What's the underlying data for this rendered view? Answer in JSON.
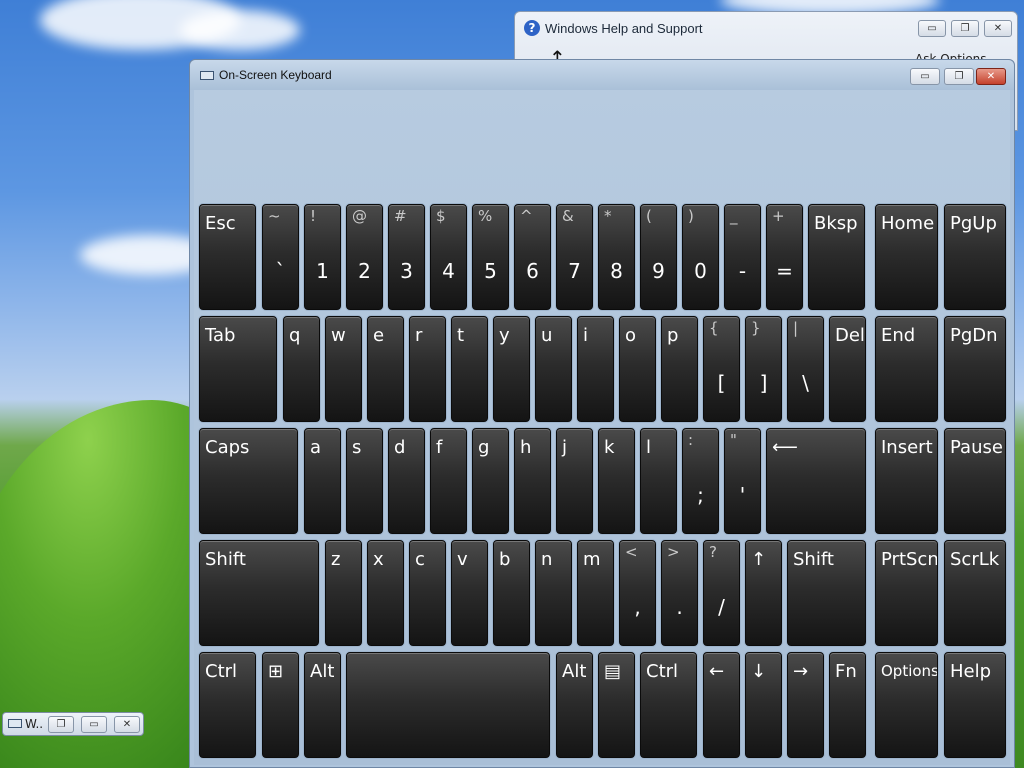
{
  "help_window": {
    "title": "Windows Help and Support",
    "icon_glyph": "?",
    "toolbar_text": "Ask   Options"
  },
  "osk_window": {
    "title": "On-Screen Keyboard"
  },
  "window_controls": {
    "minimize": "▭",
    "restore": "❐",
    "close": "✕"
  },
  "mini_window": {
    "label": "W.."
  },
  "keys": {
    "row1": [
      {
        "id": "esc",
        "label": "Esc"
      },
      {
        "id": "backtick",
        "shift": "~",
        "base": "`"
      },
      {
        "id": "1",
        "shift": "!",
        "base": "1"
      },
      {
        "id": "2",
        "shift": "@",
        "base": "2"
      },
      {
        "id": "3",
        "shift": "#",
        "base": "3"
      },
      {
        "id": "4",
        "shift": "$",
        "base": "4"
      },
      {
        "id": "5",
        "shift": "%",
        "base": "5"
      },
      {
        "id": "6",
        "shift": "^",
        "base": "6"
      },
      {
        "id": "7",
        "shift": "&",
        "base": "7"
      },
      {
        "id": "8",
        "shift": "*",
        "base": "8"
      },
      {
        "id": "9",
        "shift": "(",
        "base": "9"
      },
      {
        "id": "0",
        "shift": ")",
        "base": "0"
      },
      {
        "id": "minus",
        "shift": "_",
        "base": "-"
      },
      {
        "id": "equals",
        "shift": "+",
        "base": "="
      },
      {
        "id": "bksp",
        "label": "Bksp"
      },
      {
        "id": "home",
        "label": "Home"
      },
      {
        "id": "pgup",
        "label": "PgUp"
      }
    ],
    "row2": [
      {
        "id": "tab",
        "label": "Tab"
      },
      {
        "id": "q",
        "label": "q"
      },
      {
        "id": "w",
        "label": "w"
      },
      {
        "id": "e",
        "label": "e"
      },
      {
        "id": "r",
        "label": "r"
      },
      {
        "id": "t",
        "label": "t"
      },
      {
        "id": "y",
        "label": "y"
      },
      {
        "id": "u",
        "label": "u"
      },
      {
        "id": "i",
        "label": "i"
      },
      {
        "id": "o",
        "label": "o"
      },
      {
        "id": "p",
        "label": "p"
      },
      {
        "id": "lbracket",
        "shift": "{",
        "base": "["
      },
      {
        "id": "rbracket",
        "shift": "}",
        "base": "]"
      },
      {
        "id": "backslash",
        "shift": "|",
        "base": "\\"
      },
      {
        "id": "del",
        "label": "Del"
      },
      {
        "id": "end",
        "label": "End"
      },
      {
        "id": "pgdn",
        "label": "PgDn"
      }
    ],
    "row3": [
      {
        "id": "caps",
        "label": "Caps"
      },
      {
        "id": "a",
        "label": "a"
      },
      {
        "id": "s",
        "label": "s"
      },
      {
        "id": "d",
        "label": "d"
      },
      {
        "id": "f",
        "label": "f"
      },
      {
        "id": "g",
        "label": "g"
      },
      {
        "id": "h",
        "label": "h"
      },
      {
        "id": "j",
        "label": "j"
      },
      {
        "id": "k",
        "label": "k"
      },
      {
        "id": "l",
        "label": "l"
      },
      {
        "id": "semicolon",
        "shift": ":",
        "base": ";"
      },
      {
        "id": "quote",
        "shift": "\"",
        "base": "'"
      },
      {
        "id": "enter",
        "label": "⟵"
      },
      {
        "id": "insert",
        "label": "Insert"
      },
      {
        "id": "pause",
        "label": "Pause"
      }
    ],
    "row4": [
      {
        "id": "lshift",
        "label": "Shift"
      },
      {
        "id": "z",
        "label": "z"
      },
      {
        "id": "x",
        "label": "x"
      },
      {
        "id": "c",
        "label": "c"
      },
      {
        "id": "v",
        "label": "v"
      },
      {
        "id": "b",
        "label": "b"
      },
      {
        "id": "n",
        "label": "n"
      },
      {
        "id": "m",
        "label": "m"
      },
      {
        "id": "comma",
        "shift": "<",
        "base": ","
      },
      {
        "id": "period",
        "shift": ">",
        "base": "."
      },
      {
        "id": "slash",
        "shift": "?",
        "base": "/"
      },
      {
        "id": "up",
        "label": "↑"
      },
      {
        "id": "rshift",
        "label": "Shift"
      },
      {
        "id": "prtscn",
        "label": "PrtScn"
      },
      {
        "id": "scrlk",
        "label": "ScrLk"
      }
    ],
    "row5": [
      {
        "id": "lctrl",
        "label": "Ctrl"
      },
      {
        "id": "win",
        "label": "⊞"
      },
      {
        "id": "lalt",
        "label": "Alt"
      },
      {
        "id": "space",
        "label": ""
      },
      {
        "id": "ralt",
        "label": "Alt"
      },
      {
        "id": "menu",
        "label": "▤"
      },
      {
        "id": "rctrl",
        "label": "Ctrl"
      },
      {
        "id": "left",
        "label": "←"
      },
      {
        "id": "down",
        "label": "↓"
      },
      {
        "id": "right",
        "label": "→"
      },
      {
        "id": "fn",
        "label": "Fn"
      },
      {
        "id": "options",
        "label": "Options"
      },
      {
        "id": "help",
        "label": "Help"
      }
    ]
  }
}
